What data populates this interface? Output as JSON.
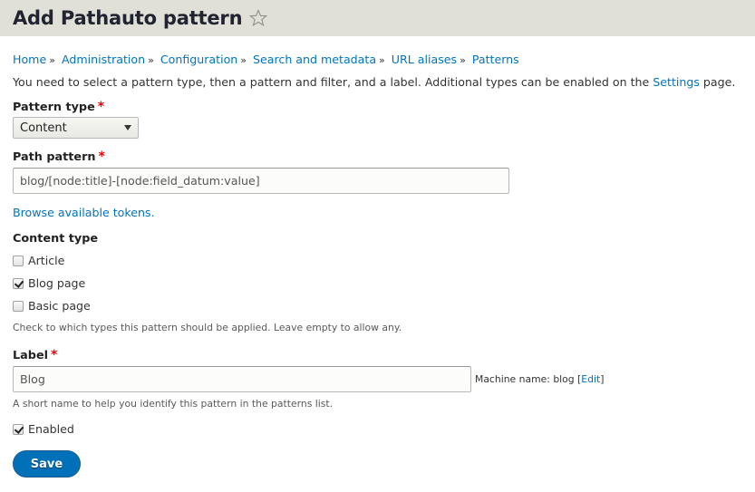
{
  "header": {
    "title": "Add Pathauto pattern",
    "shortcut_icon": "star-outline-icon"
  },
  "breadcrumb": {
    "items": [
      "Home",
      "Administration",
      "Configuration",
      "Search and metadata",
      "URL aliases",
      "Patterns"
    ],
    "separator": "»"
  },
  "intro": {
    "text_before": "You need to select a pattern type, then a pattern and filter, and a label. Additional types can be enabled on the ",
    "link": "Settings",
    "text_after": " page."
  },
  "pattern_type": {
    "label": "Pattern type",
    "required_mark": "*",
    "selected": "Content"
  },
  "path_pattern": {
    "label": "Path pattern",
    "required_mark": "*",
    "value": "blog/[node:title]-[node:field_datum:value]",
    "browse_link": "Browse available tokens."
  },
  "content_type": {
    "label": "Content type",
    "options": [
      {
        "label": "Article",
        "checked": false
      },
      {
        "label": "Blog page",
        "checked": true
      },
      {
        "label": "Basic page",
        "checked": false
      }
    ],
    "description": "Check to which types this pattern should be applied. Leave empty to allow any."
  },
  "label_field": {
    "label": "Label",
    "required_mark": "*",
    "value": "Blog",
    "machine_name_prefix": "Machine name: blog [",
    "machine_name_edit": "Edit",
    "machine_name_suffix": "]",
    "description": "A short name to help you identify this pattern in the patterns list."
  },
  "enabled": {
    "label": "Enabled",
    "checked": true
  },
  "actions": {
    "save_label": "Save"
  },
  "colors": {
    "link": "#0074bd",
    "primary_button": "#0071b8",
    "required": "#ee0000",
    "header_bg": "#e0e0d8"
  }
}
